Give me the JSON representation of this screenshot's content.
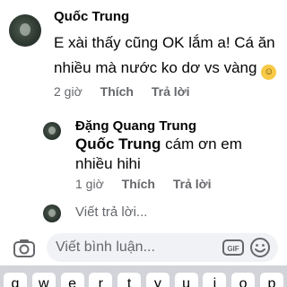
{
  "comment": {
    "author": "Quốc Trung",
    "text": "E xài thấy cũng OK lắm a! Cá ăn nhiều mà nước ko dơ vs vàng",
    "emoji": "smiling-face-emoji",
    "time": "2 giờ",
    "like_label": "Thích",
    "reply_label": "Trả lời"
  },
  "reply": {
    "author": "Đặng Quang Trung",
    "mention": "Quốc Trung",
    "text": " cám ơn em nhiều hihi",
    "time": "1 giờ",
    "like_label": "Thích",
    "reply_label": "Trả lời"
  },
  "reply_input": {
    "placeholder": "Viết trả lời..."
  },
  "composer": {
    "placeholder": "Viết bình luận...",
    "gif_label": "GIF"
  },
  "keyboard": {
    "keys": [
      "q",
      "w",
      "e",
      "r",
      "t",
      "y",
      "u",
      "i",
      "o",
      "p"
    ]
  },
  "colors": {
    "secondary_text": "#65676b",
    "field_bg": "#f0f2f5",
    "keyboard_bg": "#d2d4da"
  }
}
